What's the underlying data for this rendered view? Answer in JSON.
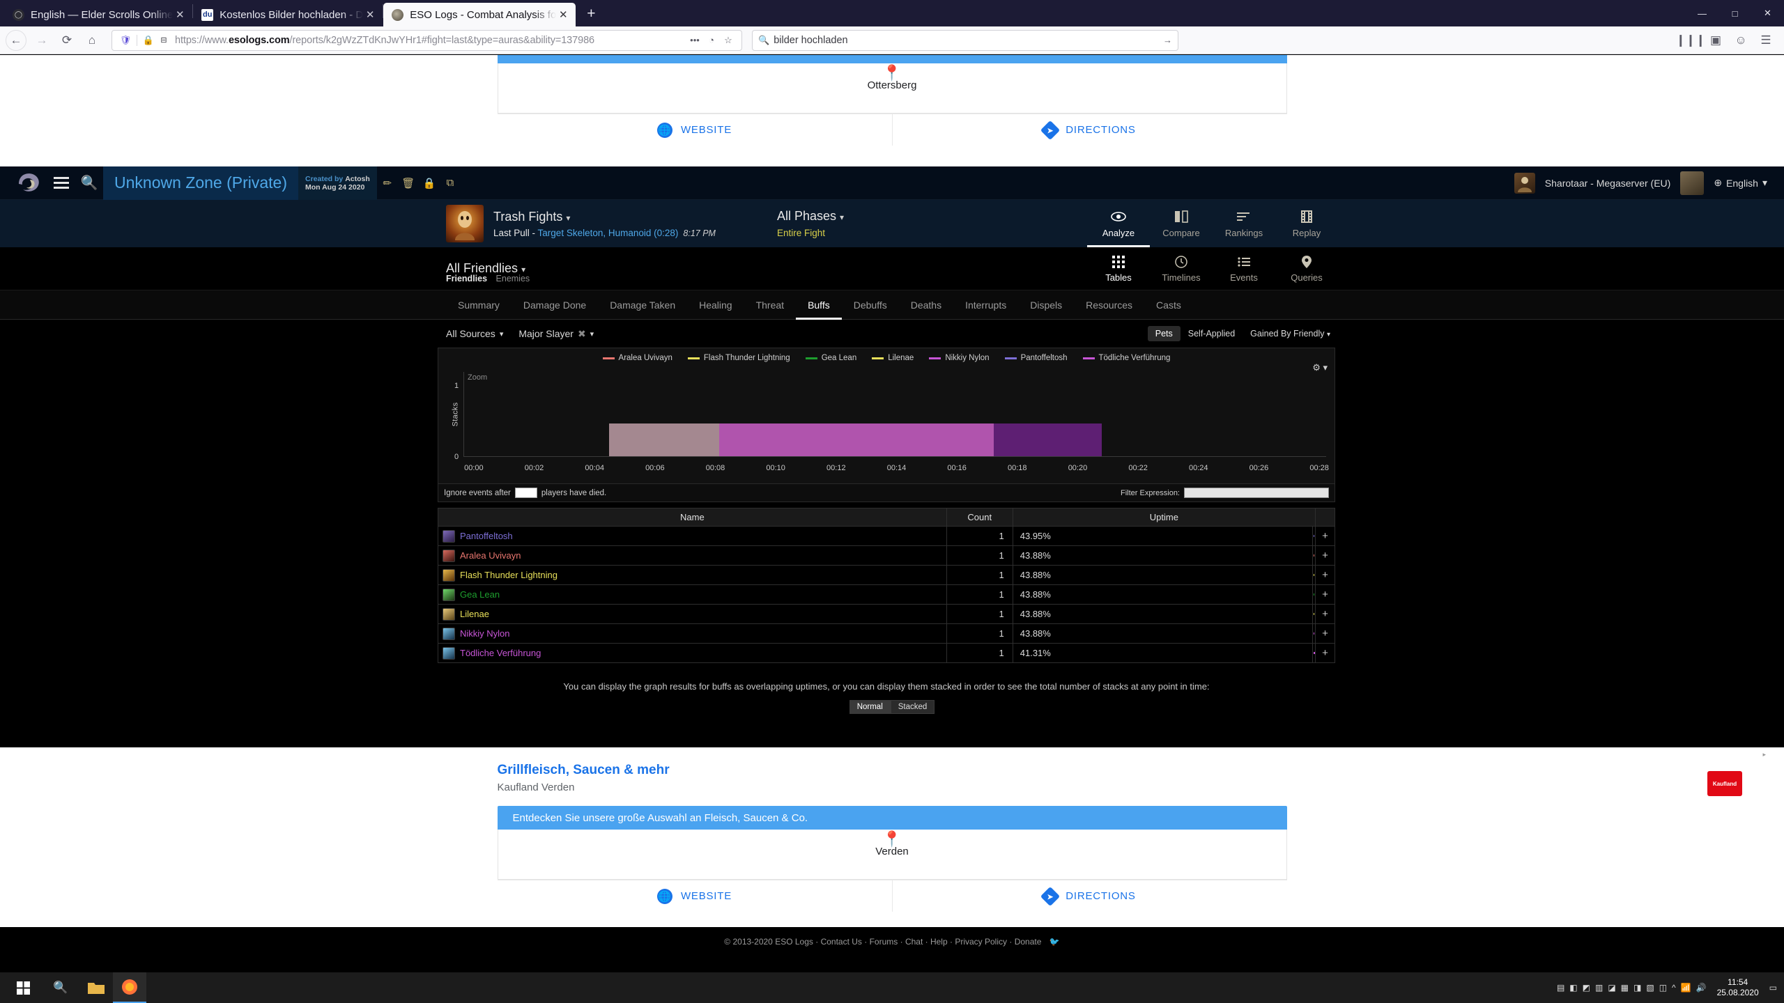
{
  "browser": {
    "tabs": [
      {
        "title": "English — Elder Scrolls Online",
        "favicon": "eso-icon",
        "active": false
      },
      {
        "title": "Kostenlos Bilder hochladen - D",
        "favicon": "du-icon",
        "active": false
      },
      {
        "title": "ESO Logs - Combat Analysis fo",
        "favicon": "esologs-icon",
        "active": true
      }
    ],
    "new_tab_label": "+",
    "window_buttons": {
      "minimize": "—",
      "maximize": "□",
      "close": "✕"
    },
    "url": "https://www.esologs.com/reports/k2gWzZTdKnJwYHr1#fight=last&type=auras&ability=137986",
    "url_prefix": "https://www.",
    "url_domain": "esologs.com",
    "url_path": "/reports/k2gWzZTdKnJwYHr1#fight=last&type=auras&ability=137986",
    "search_value": "bilder hochladen",
    "nav": {
      "back": "←",
      "forward": "→",
      "reload": "⟳",
      "home": "⌂"
    }
  },
  "ad_top": {
    "banner_text": "",
    "city": "Ottersberg",
    "website_label": "WEBSITE",
    "directions_label": "DIRECTIONS"
  },
  "site_header": {
    "zone_title": "Unknown Zone (Private)",
    "created_by_prefix": "Created by",
    "created_by_user": "Actosh",
    "created_date": "Mon Aug 24 2020",
    "icons": [
      "pencil-icon",
      "trash-icon",
      "lock-icon",
      "copy-icon"
    ],
    "account": "Sharotaar - Megaserver (EU)",
    "language": "English"
  },
  "fight_header": {
    "fight_name": "Trash Fights",
    "pull_label": "Last Pull",
    "pull_target": "Target Skeleton, Humanoid (0:28)",
    "pull_time": "8:17 PM",
    "phases_label": "All Phases",
    "phase_value": "Entire Fight",
    "view_tabs": [
      {
        "label": "Analyze",
        "icon": "eye-icon",
        "active": true
      },
      {
        "label": "Compare",
        "icon": "compare-icon",
        "active": false
      },
      {
        "label": "Rankings",
        "icon": "rankings-icon",
        "active": false
      },
      {
        "label": "Replay",
        "icon": "film-icon",
        "active": false
      }
    ]
  },
  "friendlies_bar": {
    "selector": "All Friendlies",
    "friendlies_label": "Friendlies",
    "enemies_label": "Enemies",
    "sub_tabs": [
      {
        "label": "Tables",
        "icon": "grid-icon",
        "active": true
      },
      {
        "label": "Timelines",
        "icon": "clock-icon",
        "active": false
      },
      {
        "label": "Events",
        "icon": "list-icon",
        "active": false
      },
      {
        "label": "Queries",
        "icon": "pin-icon",
        "active": false
      }
    ]
  },
  "nav_tabs": [
    {
      "label": "Summary",
      "active": false
    },
    {
      "label": "Damage Done",
      "active": false
    },
    {
      "label": "Damage Taken",
      "active": false
    },
    {
      "label": "Healing",
      "active": false
    },
    {
      "label": "Threat",
      "active": false
    },
    {
      "label": "Buffs",
      "active": true
    },
    {
      "label": "Debuffs",
      "active": false
    },
    {
      "label": "Deaths",
      "active": false
    },
    {
      "label": "Interrupts",
      "active": false
    },
    {
      "label": "Dispels",
      "active": false
    },
    {
      "label": "Resources",
      "active": false
    },
    {
      "label": "Casts",
      "active": false
    }
  ],
  "filters": {
    "sources": "All Sources",
    "ability": "Major Slayer",
    "pets": "Pets",
    "self_applied": "Self-Applied",
    "gained_by": "Gained By Friendly"
  },
  "chart_data": {
    "type": "area",
    "title": "",
    "xlabel": "",
    "ylabel": "Stacks",
    "zoom_hint": "Zoom",
    "ylim": [
      0,
      1
    ],
    "yticks": [
      "0",
      "1"
    ],
    "xticks": [
      "00:00",
      "00:02",
      "00:04",
      "00:06",
      "00:08",
      "00:10",
      "00:12",
      "00:14",
      "00:16",
      "00:18",
      "00:20",
      "00:22",
      "00:24",
      "00:26",
      "00:28"
    ],
    "legend_position": "top",
    "series": [
      {
        "name": "Aralea Uvivayn",
        "color": "#e8766f"
      },
      {
        "name": "Flash Thunder Lightning",
        "color": "#e8e05a"
      },
      {
        "name": "Gea Lean",
        "color": "#1e9e2e"
      },
      {
        "name": "Lilenae",
        "color": "#e8e05a"
      },
      {
        "name": "Nikkiy Nylon",
        "color": "#c755d6"
      },
      {
        "name": "Pantoffeltosh",
        "color": "#7d6fd6"
      },
      {
        "name": "Tödliche Verführung",
        "color": "#c755d6"
      }
    ],
    "segments": [
      {
        "start_pct": 16.8,
        "width_pct": 12.8,
        "color": "#a48890",
        "height_pct": 100
      },
      {
        "start_pct": 29.6,
        "width_pct": 31.8,
        "color": "#b054ad",
        "height_pct": 100
      },
      {
        "start_pct": 61.4,
        "width_pct": 12.6,
        "color": "#5e1f73",
        "height_pct": 100
      }
    ]
  },
  "ignore_row": {
    "prefix": "Ignore events after",
    "value": "",
    "suffix": "players have died.",
    "filter_label": "Filter Expression:",
    "filter_value": ""
  },
  "table": {
    "columns": [
      "Name",
      "Count",
      "Uptime"
    ],
    "rows": [
      {
        "name": "Pantoffeltosh",
        "count": "1",
        "uptime": "43.95%",
        "color": "#7d6fd6",
        "bar_start_pct": 30.5,
        "bar_width_pct": 48.5
      },
      {
        "name": "Aralea Uvivayn",
        "count": "1",
        "uptime": "43.88%",
        "color": "#e8766f",
        "bar_start_pct": 30.5,
        "bar_width_pct": 48.5
      },
      {
        "name": "Flash Thunder Lightning",
        "count": "1",
        "uptime": "43.88%",
        "color": "#e8e05a",
        "bar_start_pct": 30.5,
        "bar_width_pct": 48.5
      },
      {
        "name": "Gea Lean",
        "count": "1",
        "uptime": "43.88%",
        "color": "#1e9e2e",
        "bar_start_pct": 30.5,
        "bar_width_pct": 48.5
      },
      {
        "name": "Lilenae",
        "count": "1",
        "uptime": "43.88%",
        "color": "#e8e05a",
        "bar_start_pct": 30.5,
        "bar_width_pct": 48.5
      },
      {
        "name": "Nikkiy Nylon",
        "count": "1",
        "uptime": "43.88%",
        "color": "#c755d6",
        "bar_start_pct": 30.5,
        "bar_width_pct": 48.5
      },
      {
        "name": "Tödliche Verführung",
        "count": "1",
        "uptime": "41.31%",
        "color": "#c755d6",
        "bar_start_pct": 53.5,
        "bar_width_pct": 32.0
      }
    ],
    "add_label": "+"
  },
  "explanation": "You can display the graph results for buffs as overlapping uptimes, or you can display them stacked in order to see the total number of stacks at any point in time:",
  "modes": [
    {
      "label": "Normal",
      "active": true
    },
    {
      "label": "Stacked",
      "active": false
    }
  ],
  "ad_bottom": {
    "ad_marker": "▸",
    "title": "Grillfleisch, Saucen & mehr",
    "subtitle": "Kaufland Verden",
    "banner_text": "Entdecken Sie unsere große Auswahl an Fleisch, Saucen & Co.",
    "city": "Verden",
    "website_label": "WEBSITE",
    "directions_label": "DIRECTIONS",
    "logo_text": "Kaufland"
  },
  "footer": {
    "text": "© 2013-2020 ESO Logs",
    "links": [
      "Contact Us",
      "Forums",
      "Chat",
      "Help",
      "Privacy Policy",
      "Donate"
    ]
  },
  "taskbar": {
    "start": "⊞",
    "search": "search-icon",
    "time": "11:54",
    "date": "25.08.2020"
  }
}
